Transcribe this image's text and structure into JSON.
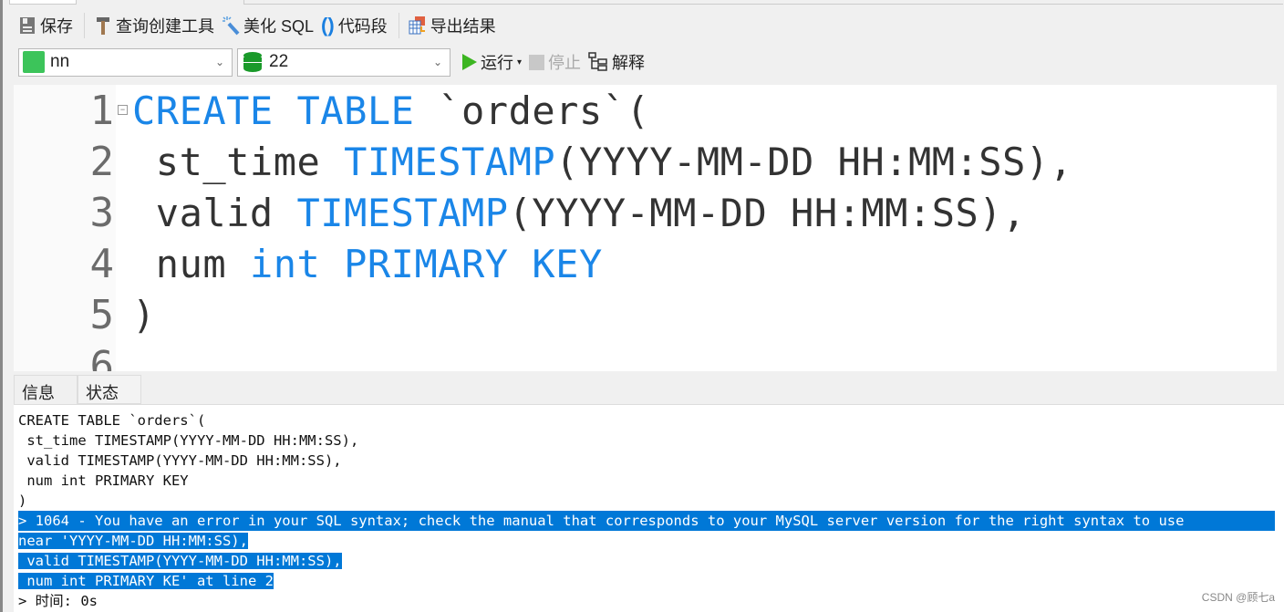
{
  "toolbar": {
    "save": "保存",
    "query_builder": "查询创建工具",
    "beautify": "美化 SQL",
    "snippet": "代码段",
    "export": "导出结果"
  },
  "toolbar2": {
    "connection": "nn",
    "database": "22",
    "run": "运行",
    "stop": "停止",
    "explain": "解释"
  },
  "editor": {
    "line_numbers": [
      "1",
      "2",
      "3",
      "4",
      "5",
      "6"
    ],
    "lines": [
      [
        {
          "t": "CREATE TABLE",
          "k": 1
        },
        {
          "t": " `orders`(",
          "k": 0
        }
      ],
      [
        {
          "t": " st_time ",
          "k": 0
        },
        {
          "t": "TIMESTAMP",
          "k": 1
        },
        {
          "t": "(YYYY-MM-DD HH:MM:SS),",
          "k": 0
        }
      ],
      [
        {
          "t": " valid ",
          "k": 0
        },
        {
          "t": "TIMESTAMP",
          "k": 1
        },
        {
          "t": "(YYYY-MM-DD HH:MM:SS),",
          "k": 0
        }
      ],
      [
        {
          "t": " num ",
          "k": 0
        },
        {
          "t": "int PRIMARY KEY",
          "k": 1
        }
      ],
      [
        {
          "t": ")",
          "k": 0
        }
      ]
    ]
  },
  "panel_tabs": [
    "信息",
    "状态"
  ],
  "output": {
    "lines": [
      "CREATE TABLE `orders`(",
      "  st_time TIMESTAMP(YYYY-MM-DD HH:MM:SS),",
      "  valid TIMESTAMP(YYYY-MM-DD HH:MM:SS),",
      "  num int PRIMARY KEY",
      ")"
    ],
    "error_lines": [
      "> 1064 - You have an error in your SQL syntax; check the manual that corresponds to your MySQL server version for the right syntax to use",
      "near 'YYYY-MM-DD HH:MM:SS),",
      " valid TIMESTAMP(YYYY-MM-DD HH:MM:SS),",
      " num int PRIMARY KE' at line 2"
    ],
    "time": "> 时间: 0s"
  },
  "watermark": "CSDN @顾七a",
  "colors": {
    "keyword": "#1a86e8",
    "selection": "#0078d7",
    "run": "#3cb521"
  }
}
